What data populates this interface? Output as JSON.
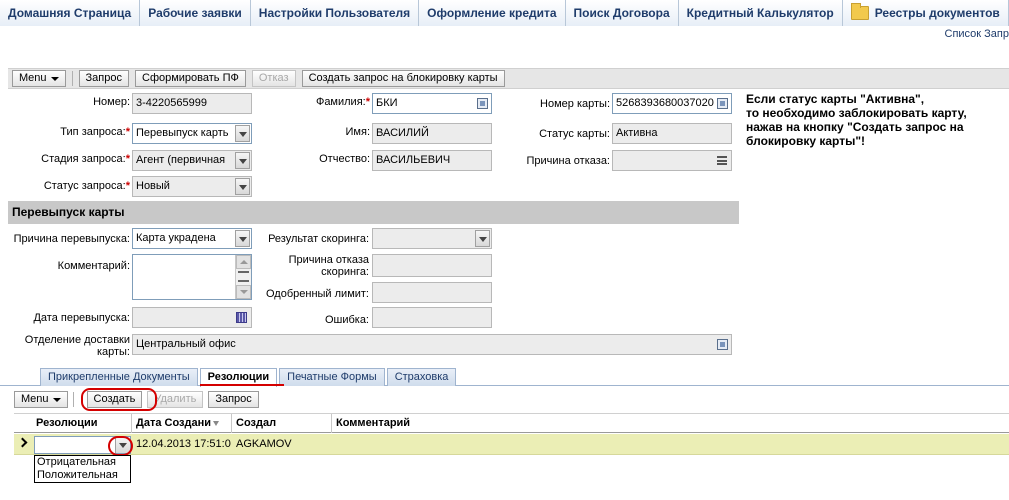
{
  "topnav": {
    "tabs": [
      "Домашняя Страница",
      "Рабочие заявки",
      "Настройки Пользователя",
      "Оформление кредита",
      "Поиск Договора",
      "Кредитный Калькулятор",
      "Реестры документов"
    ],
    "breadcrumb_link": "Список Запр"
  },
  "toolbar": {
    "menu": "Menu",
    "request": "Запрос",
    "generate_pf": "Сформировать ПФ",
    "reject": "Отказ",
    "block_request": "Создать запрос на блокировку карты"
  },
  "form": {
    "number_label": "Номер:",
    "number_value": "3-4220565999",
    "request_type_label": "Тип запроса:",
    "request_type_value": "Перевыпуск карть",
    "request_stage_label": "Стадия запроса:",
    "request_stage_value": "Агент (первичная",
    "request_status_label": "Статус запроса:",
    "request_status_value": "Новый",
    "surname_label": "Фамилия:",
    "surname_value": "БКИ",
    "name_label": "Имя:",
    "name_value": "ВАСИЛИЙ",
    "patronymic_label": "Отчество:",
    "patronymic_value": "ВАСИЛЬЕВИЧ",
    "card_number_label": "Номер карты:",
    "card_number_value": "5268393680037020",
    "card_status_label": "Статус карты:",
    "card_status_value": "Активна",
    "reject_reason_label": "Причина отказа:",
    "reject_reason_value": ""
  },
  "note": "Если статус карты \"Активна\",\nто необходимо заблокировать карту,\nнажав на кнопку \"Создать запрос на\nблокировку карты\"!",
  "reissue": {
    "section_title": "Перевыпуск карты",
    "reason_label": "Причина перевыпуска:",
    "reason_value": "Карта украдена",
    "comment_label": "Комментарий:",
    "reissue_date_label": "Дата перевыпуска:",
    "delivery_office_label": "Отделение доставки карты:",
    "delivery_office_value": "Центральный офис",
    "scoring_result_label": "Результат скоринга:",
    "scoring_reject_reason_label": "Причина отказа скоринга:",
    "approved_limit_label": "Одобренный лимит:",
    "error_label": "Ошибка:"
  },
  "subtabs": [
    "Прикрепленные Документы",
    "Резолюции",
    "Печатные Формы",
    "Страховка"
  ],
  "resolutions_toolbar": {
    "menu": "Menu",
    "create": "Создать",
    "delete": "Удалить",
    "request": "Запрос"
  },
  "grid": {
    "columns": [
      "Резолюции",
      "Дата Создани",
      "Создал",
      "Комментарий"
    ],
    "row": {
      "resolution": "",
      "created_date": "12.04.2013 17:51:0",
      "created_by": "AGKAMOV",
      "comment": ""
    },
    "dropdown_options": [
      "Отрицательная",
      "Положительная"
    ]
  },
  "colors": {
    "highlight_red": "#d40000",
    "row_selected": "#ebeeb5",
    "section_header": "#c8c8c8"
  }
}
